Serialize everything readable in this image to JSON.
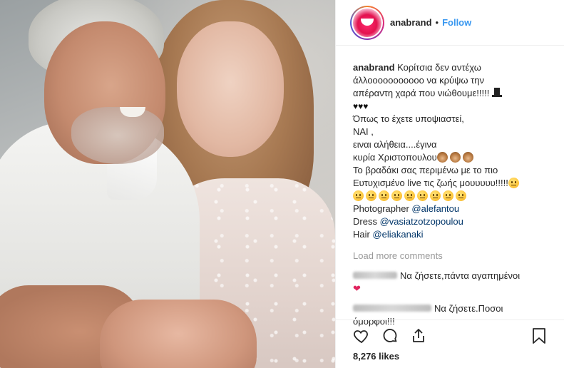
{
  "post": {
    "username": "anabrand",
    "follow_label": "Follow",
    "separator": "•",
    "caption_lines": [
      "Κορίτσια δεν αντέχω",
      "άλλοοοοοοοοοοο να κρύψω την",
      "απέραντη χαρά που νιώθουμε!!!!!",
      "Όπως το έχετε υποψιαστεί,",
      "ΝΑΙ ,",
      "ειναι αλήθεια....έγινα",
      "κυρία Χριστοπουλου",
      "Το βραδάκι σας περιμένω με το πιο",
      "Ευτυχισμένο live τις ζωής μουυυυυ!!!!!"
    ],
    "hearts": "♥♥♥",
    "credits": [
      {
        "label": "Photographer",
        "mention": "@alefantou"
      },
      {
        "label": "Dress",
        "mention": "@vasiatzotzopoulou"
      },
      {
        "label": "Hair",
        "mention": "@eliakanaki"
      }
    ],
    "load_more_label": "Load more comments",
    "comments": [
      {
        "text": "Να ζήσετε,πάντα αγαπημένοι",
        "extra": "❤"
      },
      {
        "text": "Να ζήσετε.Ποσοι",
        "continued": "όμορφοι!!!"
      }
    ],
    "likes_label": "8,276 likes"
  },
  "icons": {
    "like": "heart-outline-icon",
    "comment": "comment-bubble-icon",
    "share": "share-icon",
    "save": "bookmark-icon"
  },
  "colors": {
    "follow": "#3897f0",
    "mention": "#003569",
    "muted": "#999999"
  }
}
